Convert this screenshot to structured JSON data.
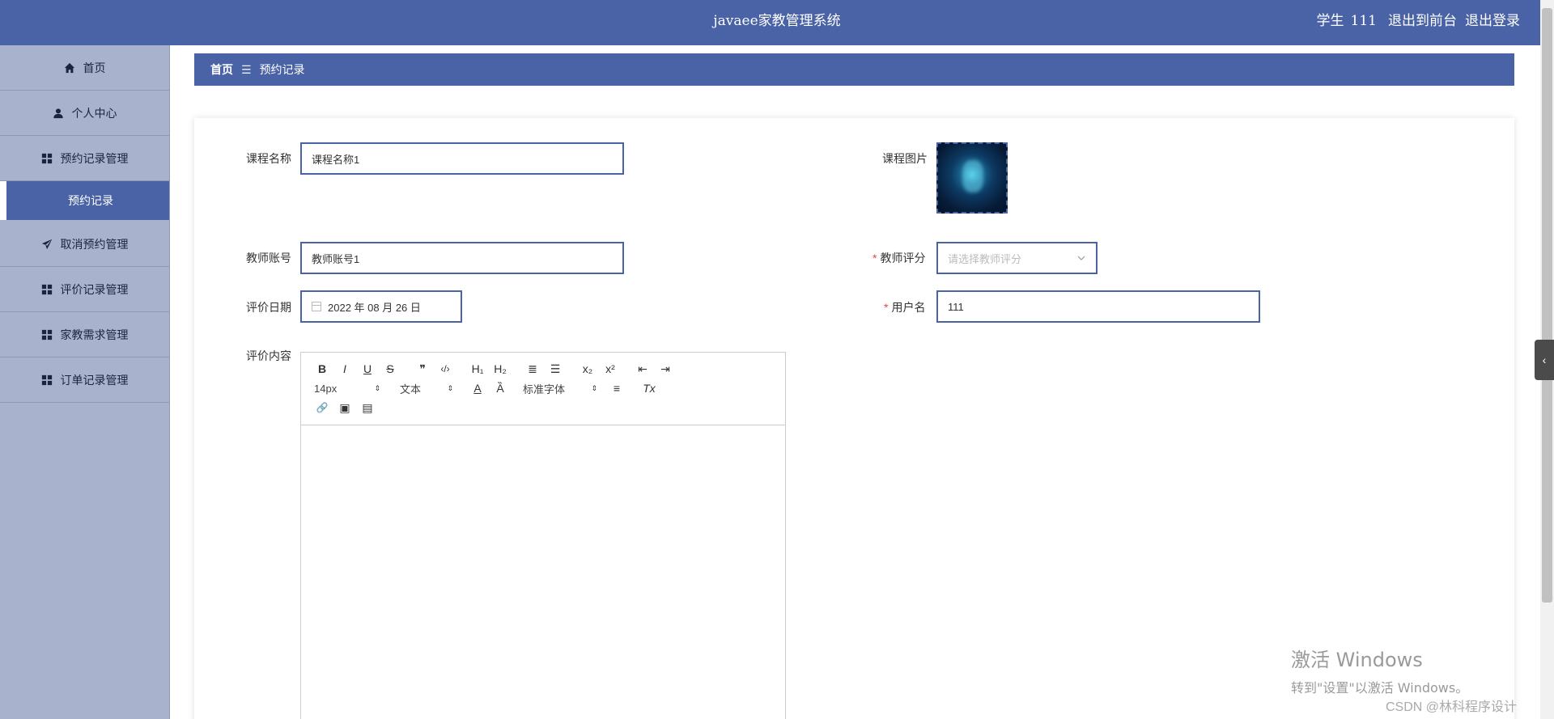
{
  "header": {
    "title": "javaee家教管理系统",
    "user_role": "学生",
    "username": "111",
    "back_to_front": "退出到前台",
    "logout": "退出登录"
  },
  "sidebar": {
    "items": [
      {
        "label": "首页",
        "icon": "home-icon"
      },
      {
        "label": "个人中心",
        "icon": "user-icon"
      },
      {
        "label": "预约记录管理",
        "icon": "grid-icon"
      },
      {
        "label": "预约记录",
        "icon": ""
      },
      {
        "label": "取消预约管理",
        "icon": "send-icon"
      },
      {
        "label": "评价记录管理",
        "icon": "grid-icon"
      },
      {
        "label": "家教需求管理",
        "icon": "grid-icon"
      },
      {
        "label": "订单记录管理",
        "icon": "grid-icon"
      }
    ]
  },
  "breadcrumb": {
    "home": "首页",
    "separator": "☰",
    "current": "预约记录"
  },
  "form": {
    "course_name_label": "课程名称",
    "course_name_value": "课程名称1",
    "course_image_label": "课程图片",
    "teacher_account_label": "教师账号",
    "teacher_account_value": "教师账号1",
    "teacher_rating_label": "教师评分",
    "teacher_rating_placeholder": "请选择教师评分",
    "review_date_label": "评价日期",
    "review_date_value": "2022 年 08 月 26 日",
    "username_label": "用户名",
    "username_value": "111",
    "review_content_label": "评价内容",
    "required_mark": "*"
  },
  "editor": {
    "font_size": "14px",
    "text_style": "文本",
    "font_family": "标准字体",
    "buttons_row1": [
      "B",
      "I",
      "U",
      "S",
      "❞",
      "‹/›",
      "H₁",
      "H₂",
      "≣",
      "☰",
      "x₂",
      "x²",
      "⇤",
      "⇥"
    ],
    "buttons_row2_icons": [
      "A",
      "Ȁ",
      "≡",
      "Tx"
    ],
    "buttons_row3": [
      "🔗",
      "▣",
      "▤"
    ]
  },
  "watermark": {
    "line1": "激活 Windows",
    "line2": "转到\"设置\"以激活 Windows。",
    "csdn": "CSDN @林科程序设计"
  },
  "colors": {
    "primary": "#4a63a6",
    "sidebar_bg": "#a9b2cd",
    "required": "#e24a4a"
  }
}
